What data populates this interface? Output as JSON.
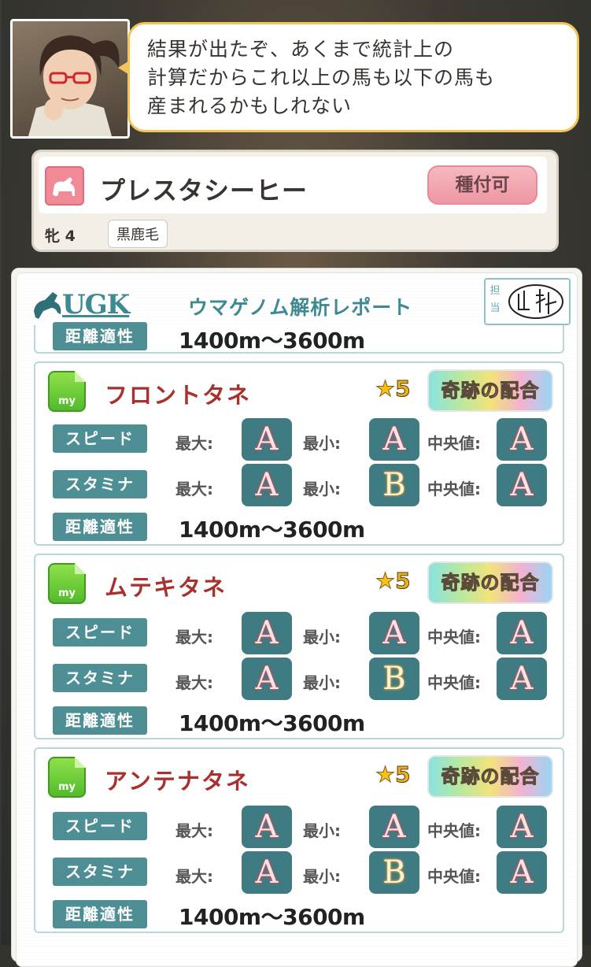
{
  "dialog": {
    "lines": [
      "結果が出たぞ、あくまで統計上の",
      "計算だからこれ以上の馬も以下の馬も",
      "産まれるかもしれない"
    ]
  },
  "horse": {
    "name": "プレスタシーヒー",
    "breed_button": "種付可",
    "sex_age": "牝 4",
    "coat": "黒鹿毛"
  },
  "report": {
    "logo_text": "UGK",
    "title": "ウマゲノム解析レポート",
    "stamp_label": "担当",
    "top_partial": {
      "distance_label": "距離適性",
      "distance_value": "1400m〜3600m"
    },
    "labels": {
      "speed": "スピード",
      "stamina": "スタミナ",
      "distance": "距離適性",
      "max": "最大:",
      "min": "最小:",
      "median": "中央値:"
    },
    "seeds": [
      {
        "name": "フロントタネ",
        "stars": "5",
        "rank": "奇跡の配合",
        "speed": {
          "max": "A",
          "min": "A",
          "median": "A"
        },
        "stamina": {
          "max": "A",
          "min": "B",
          "median": "A"
        },
        "distance": "1400m〜3600m"
      },
      {
        "name": "ムテキタネ",
        "stars": "5",
        "rank": "奇跡の配合",
        "speed": {
          "max": "A",
          "min": "A",
          "median": "A"
        },
        "stamina": {
          "max": "A",
          "min": "B",
          "median": "A"
        },
        "distance": "1400m〜3600m"
      },
      {
        "name": "アンテナタネ",
        "stars": "5",
        "rank": "奇跡の配合",
        "speed": {
          "max": "A",
          "min": "A",
          "median": "A"
        },
        "stamina": {
          "max": "A",
          "min": "B",
          "median": "A"
        },
        "distance": "1400m〜3600m"
      }
    ]
  },
  "icons": {
    "my_label": "my",
    "star_glyph": "★"
  }
}
